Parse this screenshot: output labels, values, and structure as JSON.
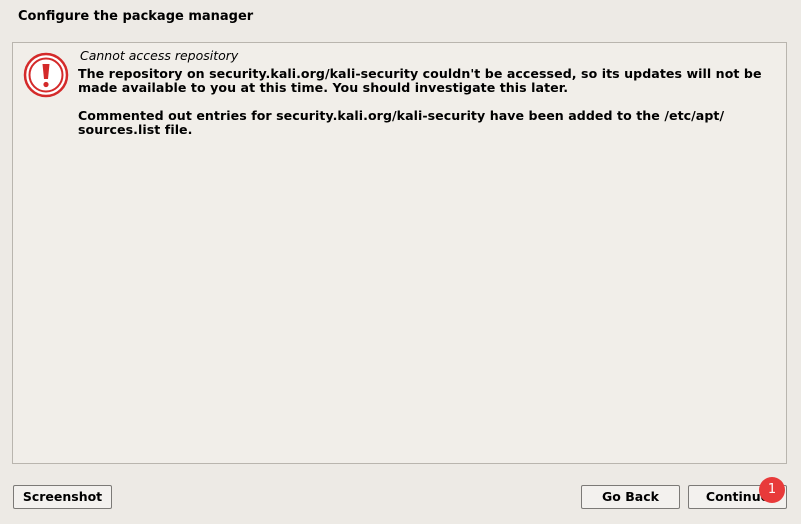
{
  "header": {
    "title": "Configure the package manager"
  },
  "message": {
    "icon": "error-exclamation-icon",
    "icon_color": "#d42a2a",
    "title": "Cannot access repository",
    "paragraph_1": "The repository on security.kali.org/kali-security couldn't be accessed, so its updates will not be made available to you at this time. You should investigate this later.",
    "paragraph_2": "Commented out entries for security.kali.org/kali-security have been added to the /etc/apt/ sources.list file."
  },
  "buttons": {
    "screenshot": "Screenshot",
    "go_back": "Go Back",
    "continue": "Continue"
  },
  "badge": {
    "count": "1",
    "color": "#e83a3a"
  }
}
